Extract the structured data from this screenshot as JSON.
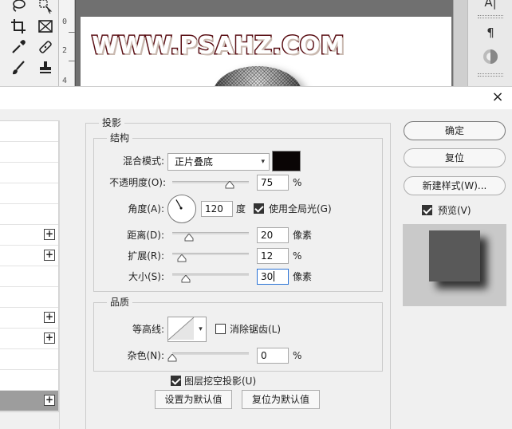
{
  "background": {
    "ruler_ticks": [
      "0",
      "2",
      "4"
    ],
    "document_text": "WWW.PSAHZ.COM",
    "right_panel": {
      "text_tool_label": "A|",
      "paragraph_label": "¶"
    }
  },
  "dialog": {
    "style_list_plus": "+",
    "shadow_section": {
      "title": "投影",
      "structure_group": {
        "title": "结构",
        "blend_mode_label": "混合模式:",
        "blend_mode_value": "正片叠底",
        "blend_color": "#0a0505",
        "opacity_label": "不透明度(O):",
        "opacity_value": "75",
        "opacity_unit": "%",
        "opacity_level": 75,
        "angle_label": "角度(A):",
        "angle_value": "120",
        "angle_unit": "度",
        "global_light_label": "使用全局光(G)",
        "global_light_checked": true,
        "distance_label": "距离(D):",
        "distance_value": "20",
        "distance_unit": "像素",
        "spread_label": "扩展(R):",
        "spread_value": "12",
        "spread_unit": "%",
        "size_label": "大小(S):",
        "size_value": "30",
        "size_unit": "像素"
      },
      "quality_group": {
        "title": "品质",
        "contour_label": "等高线:",
        "anti_alias_label": "消除锯齿(L)",
        "anti_alias_checked": false,
        "noise_label": "杂色(N):",
        "noise_value": "0",
        "noise_unit": "%"
      },
      "knockout_label": "图层挖空投影(U)",
      "knockout_checked": true,
      "make_default_label": "设置为默认值",
      "reset_default_label": "复位为默认值"
    },
    "buttons": {
      "ok_label": "确定",
      "reset_label": "复位",
      "new_style_label": "新建样式(W)...",
      "preview_label": "预览(V)",
      "preview_checked": true
    },
    "close_glyph": "×"
  }
}
